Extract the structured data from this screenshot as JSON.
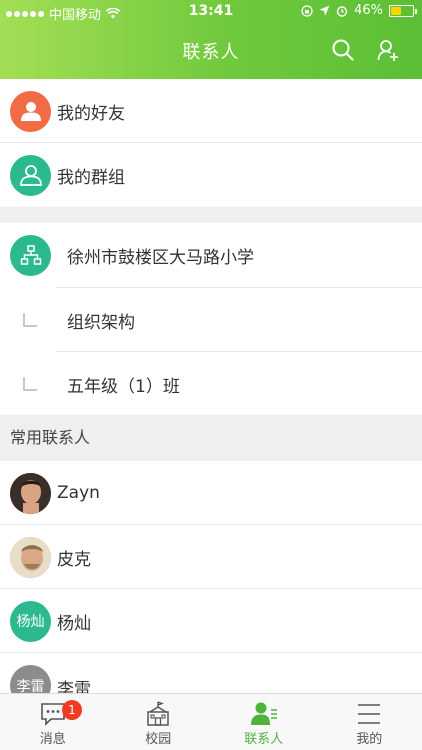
{
  "status_bar": {
    "carrier": "中国移动",
    "time": "13:41",
    "battery": "46%",
    "battery_level": 0.46
  },
  "header": {
    "title": "联系人"
  },
  "groups": [
    {
      "label": "我的好友",
      "color": "#f06c47",
      "icon": "person-icon"
    },
    {
      "label": "我的群组",
      "color": "#2db98f",
      "icon": "group-icon"
    }
  ],
  "org": {
    "school": "徐州市鼓楼区大马路小学",
    "school_color": "#2db98f",
    "children": [
      "组织架构",
      "五年级（1）班"
    ]
  },
  "frequent": {
    "header": "常用联系人",
    "contacts": [
      {
        "name": "Zayn",
        "avatar_text": "",
        "avatar_color": "#7a5a48"
      },
      {
        "name": "皮克",
        "avatar_text": "",
        "avatar_color": "#c9a57c"
      },
      {
        "name": "杨灿",
        "avatar_text": "杨灿",
        "avatar_color": "#2db98f"
      },
      {
        "name": "李雷",
        "avatar_text": "李雷",
        "avatar_color": "#8c8c8c"
      }
    ]
  },
  "tabbar": {
    "tabs": [
      {
        "label": "消息",
        "badge": "1"
      },
      {
        "label": "校园"
      },
      {
        "label": "联系人"
      },
      {
        "label": "我的"
      }
    ],
    "active_color": "#4db33d"
  }
}
